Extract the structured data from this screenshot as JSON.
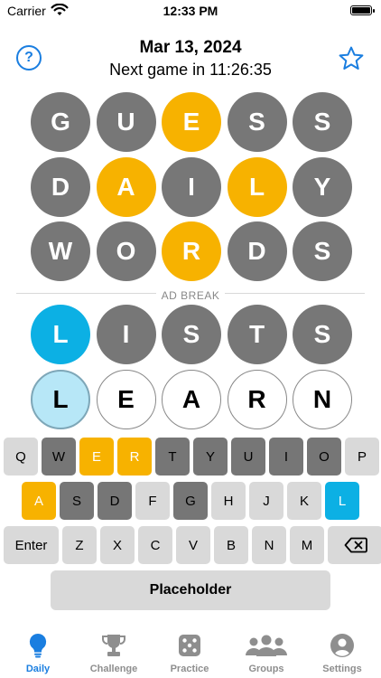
{
  "status_bar": {
    "carrier": "Carrier",
    "time": "12:33 PM"
  },
  "header": {
    "date": "Mar 13, 2024",
    "next_game": "Next game in 11:26:35",
    "help_label": "?"
  },
  "grid": {
    "rows": [
      [
        {
          "letter": "G",
          "state": "gray"
        },
        {
          "letter": "U",
          "state": "gray"
        },
        {
          "letter": "E",
          "state": "yellow"
        },
        {
          "letter": "S",
          "state": "gray"
        },
        {
          "letter": "S",
          "state": "gray"
        }
      ],
      [
        {
          "letter": "D",
          "state": "gray"
        },
        {
          "letter": "A",
          "state": "yellow"
        },
        {
          "letter": "I",
          "state": "gray"
        },
        {
          "letter": "L",
          "state": "yellow"
        },
        {
          "letter": "Y",
          "state": "gray"
        }
      ],
      [
        {
          "letter": "W",
          "state": "gray"
        },
        {
          "letter": "O",
          "state": "gray"
        },
        {
          "letter": "R",
          "state": "yellow"
        },
        {
          "letter": "D",
          "state": "gray"
        },
        {
          "letter": "S",
          "state": "gray"
        }
      ]
    ],
    "ad_break": "AD BREAK",
    "rows_after": [
      [
        {
          "letter": "L",
          "state": "blue"
        },
        {
          "letter": "I",
          "state": "gray"
        },
        {
          "letter": "S",
          "state": "gray"
        },
        {
          "letter": "T",
          "state": "gray"
        },
        {
          "letter": "S",
          "state": "gray"
        }
      ],
      [
        {
          "letter": "L",
          "state": "active"
        },
        {
          "letter": "E",
          "state": "empty"
        },
        {
          "letter": "A",
          "state": "empty"
        },
        {
          "letter": "R",
          "state": "empty"
        },
        {
          "letter": "N",
          "state": "empty"
        }
      ]
    ]
  },
  "keyboard": {
    "row1": [
      {
        "k": "Q",
        "s": "light"
      },
      {
        "k": "W",
        "s": "dark"
      },
      {
        "k": "E",
        "s": "yellow"
      },
      {
        "k": "R",
        "s": "yellow"
      },
      {
        "k": "T",
        "s": "dark"
      },
      {
        "k": "Y",
        "s": "dark"
      },
      {
        "k": "U",
        "s": "dark"
      },
      {
        "k": "I",
        "s": "dark"
      },
      {
        "k": "O",
        "s": "dark"
      },
      {
        "k": "P",
        "s": "light"
      }
    ],
    "row2": [
      {
        "k": "A",
        "s": "yellow"
      },
      {
        "k": "S",
        "s": "dark"
      },
      {
        "k": "D",
        "s": "dark"
      },
      {
        "k": "F",
        "s": "light"
      },
      {
        "k": "G",
        "s": "dark"
      },
      {
        "k": "H",
        "s": "light"
      },
      {
        "k": "J",
        "s": "light"
      },
      {
        "k": "K",
        "s": "light"
      },
      {
        "k": "L",
        "s": "blue"
      }
    ],
    "enter_label": "Enter",
    "row3": [
      {
        "k": "Z",
        "s": "light"
      },
      {
        "k": "X",
        "s": "light"
      },
      {
        "k": "C",
        "s": "light"
      },
      {
        "k": "V",
        "s": "light"
      },
      {
        "k": "B",
        "s": "light"
      },
      {
        "k": "N",
        "s": "light"
      },
      {
        "k": "M",
        "s": "light"
      }
    ],
    "placeholder_label": "Placeholder"
  },
  "tabs": [
    {
      "label": "Daily",
      "icon": "lightbulb-icon",
      "active": true
    },
    {
      "label": "Challenge",
      "icon": "trophy-icon",
      "active": false
    },
    {
      "label": "Practice",
      "icon": "dice-icon",
      "active": false
    },
    {
      "label": "Groups",
      "icon": "people-icon",
      "active": false
    },
    {
      "label": "Settings",
      "icon": "person-circle-icon",
      "active": false
    }
  ],
  "colors": {
    "accent": "#1a7ee0",
    "gray": "#777777",
    "yellow": "#f7b200",
    "blue": "#0cb0e4",
    "key_light": "#d9d9d9"
  }
}
